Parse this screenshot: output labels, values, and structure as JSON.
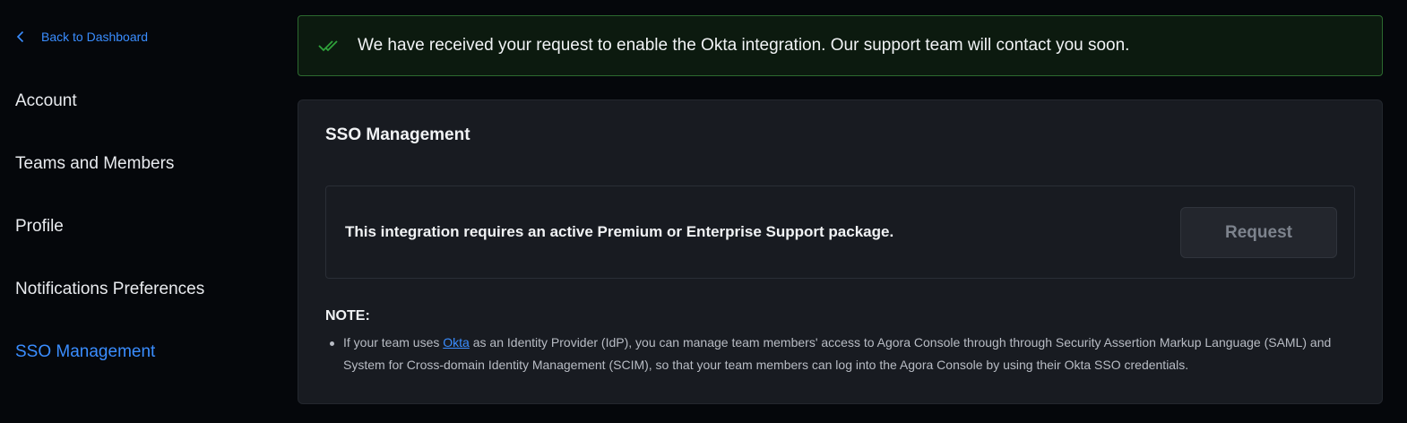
{
  "sidebar": {
    "back_label": "Back to Dashboard",
    "items": [
      {
        "label": "Account",
        "active": false
      },
      {
        "label": "Teams and Members",
        "active": false
      },
      {
        "label": "Profile",
        "active": false
      },
      {
        "label": "Notifications Preferences",
        "active": false
      },
      {
        "label": "SSO Management",
        "active": true
      }
    ]
  },
  "alert": {
    "icon": "double-check-icon",
    "message": "We have received your request to enable the Okta integration. Our support team will contact you soon."
  },
  "card": {
    "title": "SSO Management",
    "requirement_text": "This integration requires an active Premium or Enterprise Support package.",
    "request_button_label": "Request",
    "note_title": "NOTE:",
    "note_prefix": "If your team uses ",
    "note_link": "Okta",
    "note_suffix": " as an Identity Provider (IdP), you can manage team members' access to Agora Console through through Security Assertion Markup Language (SAML) and System for Cross-domain Identity Management (SCIM), so that your team members can log into the Agora Console by using their Okta SSO credentials."
  },
  "colors": {
    "accent": "#3a8dff",
    "success_border": "#2c6a2f",
    "success_icon": "#2fa23a",
    "background": "#05070b",
    "card": "#181b21"
  }
}
